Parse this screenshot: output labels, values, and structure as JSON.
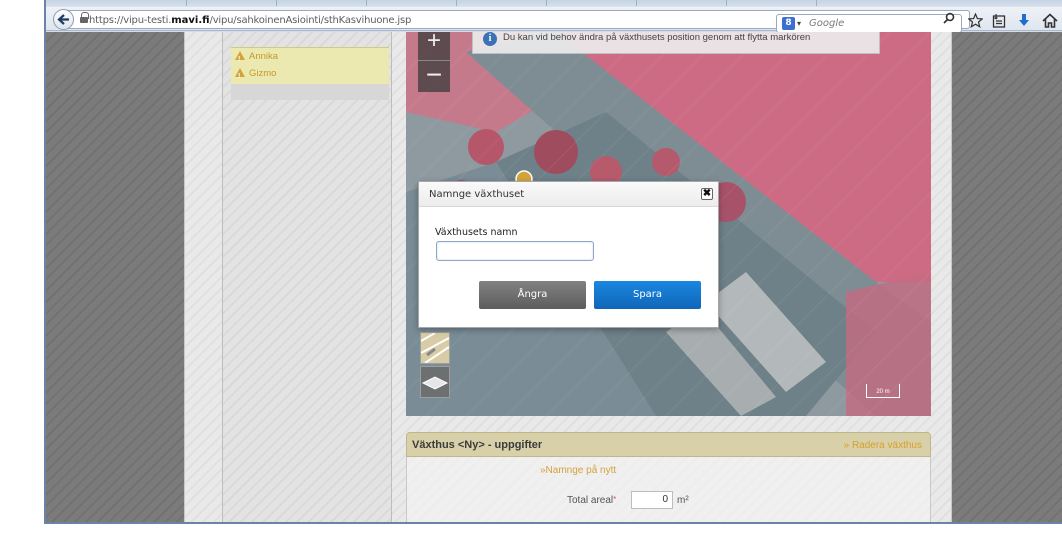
{
  "browser": {
    "url_prefix": "https://vipu-testi.",
    "url_domain": "mavi.fi",
    "url_path": "/vipu/sahkoinenAsiointi/sthKasvihuone.jsp",
    "url_tail_icons": "▿ C",
    "search_engine_icon": "8",
    "search_engine_arrow": "▾",
    "search_placeholder": "Google",
    "icons": [
      "back-arrow-icon",
      "lock-icon",
      "search-icon",
      "star-icon",
      "bookmarks-icon",
      "download-icon",
      "home-icon"
    ]
  },
  "sidebar": {
    "items": [
      {
        "label": "Annika"
      },
      {
        "label": "Gizmo"
      }
    ]
  },
  "map": {
    "zoom_in": "+",
    "zoom_out": "−",
    "info_text": "Du kan vid behov ändra på växthusets position genom att flytta markören",
    "scale_label": "20 m"
  },
  "details": {
    "title": "Växthus <Ny> - uppgifter",
    "delete_link": "» Radera växthus",
    "rename_link": "»Namnge på nytt",
    "area_label": "Total areal",
    "area_required": "*",
    "area_value": "0",
    "area_unit": "m²"
  },
  "dialog": {
    "title": "Namnge växthuset",
    "close": "✖",
    "field_label": "Växthusets namn",
    "field_value": "",
    "cancel_label": "Ångra",
    "save_label": "Spara"
  },
  "colors": {
    "save_button": "#1a7bd1",
    "cancel_button": "#6d6d6d",
    "sidebar_warning": "#d2a43a",
    "map_overlay": "#e0566f"
  }
}
